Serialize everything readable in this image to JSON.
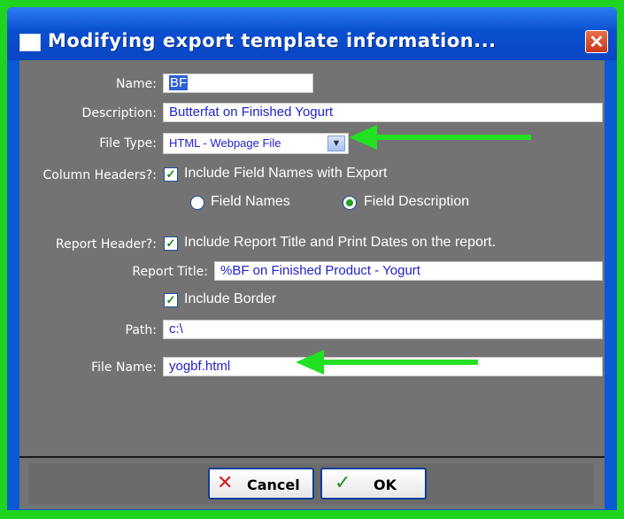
{
  "window": {
    "title": "Modifying export template information...",
    "close_glyph": "✕"
  },
  "form": {
    "name_label": "Name:",
    "name_value": "BF",
    "description_label": "Description:",
    "description_value": "Butterfat on Finished Yogurt",
    "file_type_label": "File Type:",
    "file_type_value": "HTML - Webpage File",
    "column_headers_label": "Column Headers?:",
    "include_field_names_label": "Include Field Names with Export",
    "include_field_names_checked": true,
    "radio_field_names_label": "Field Names",
    "radio_field_description_label": "Field Description",
    "radio_selected": "Field Description",
    "report_header_label": "Report Header?:",
    "include_report_title_label": "Include Report Title and Print Dates on the report.",
    "include_report_title_checked": true,
    "report_title_label": "Report Title:",
    "report_title_value": "%BF on Finished Product - Yogurt",
    "include_border_label": "Include Border",
    "include_border_checked": true,
    "path_label": "Path:",
    "path_value": "c:\\",
    "file_name_label": "File Name:",
    "file_name_value": "yogbf.html"
  },
  "buttons": {
    "cancel_label": "Cancel",
    "ok_label": "OK"
  },
  "icons": {
    "cancel": "x-icon",
    "ok": "checkmark-icon",
    "window": "window-icon"
  },
  "colors": {
    "title_bar": "#0a52d4",
    "client_bg": "#737373",
    "field_text": "#2222cc",
    "annotation_arrow": "#22e022",
    "outer_border": "#1fd41f"
  }
}
